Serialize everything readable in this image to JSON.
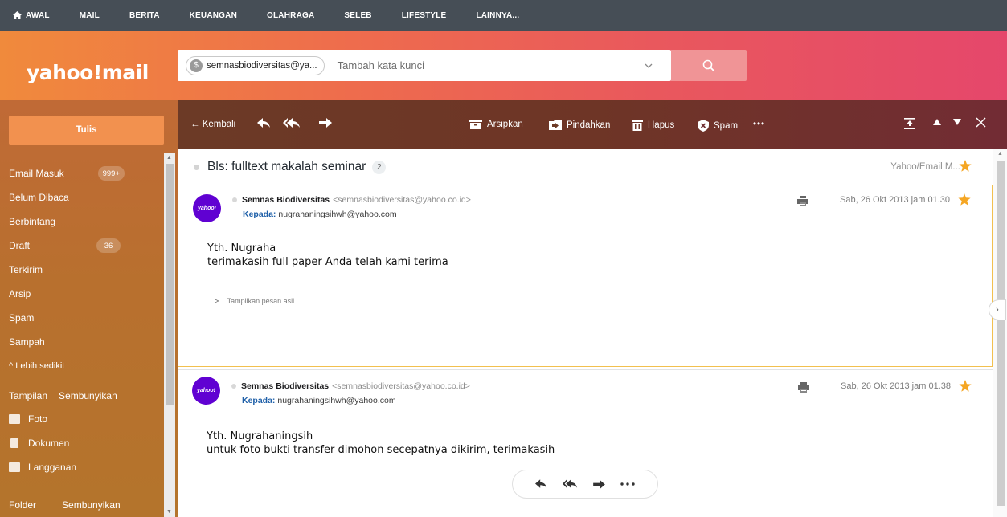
{
  "topnav": {
    "items": [
      "AWAL",
      "MAIL",
      "BERITA",
      "KEUANGAN",
      "OLAHRAGA",
      "SELEB",
      "LIFESTYLE",
      "LAINNYA..."
    ]
  },
  "header": {
    "logo": "yahoo!mail",
    "search": {
      "account_chip": "semnasbiodiversitas@ya...",
      "placeholder": "Tambah kata kunci"
    }
  },
  "sidebar": {
    "compose_label": "Tulis",
    "folders": [
      {
        "label": "Email Masuk",
        "badge": "999+"
      },
      {
        "label": "Belum Dibaca",
        "badge": ""
      },
      {
        "label": "Berbintang",
        "badge": ""
      },
      {
        "label": "Draft",
        "badge": "36"
      },
      {
        "label": "Terkirim",
        "badge": ""
      },
      {
        "label": "Arsip",
        "badge": ""
      },
      {
        "label": "Spam",
        "badge": ""
      },
      {
        "label": "Sampah",
        "badge": ""
      }
    ],
    "less_label": "^ Lebih sedikit",
    "views_label": "Tampilan",
    "views_hide": "Sembunyikan",
    "views": [
      "Foto",
      "Dokumen",
      "Langganan"
    ],
    "folder_label": "Folder",
    "folder_hide": "Sembunyikan"
  },
  "toolbar": {
    "back_label": "← Kembali",
    "archive_label": "Arsipkan",
    "move_label": "Pindahkan",
    "delete_label": "Hapus",
    "spam_label": "Spam",
    "more_label": "•••"
  },
  "conversation": {
    "subject": "Bls: fulltext makalah seminar",
    "count": "2",
    "folder": "Yahoo/Email M...",
    "messages": [
      {
        "avatar": "yahoo!",
        "sender_name": "Semnas Biodiversitas",
        "sender_email": "<semnasbiodiversitas@yahoo.co.id>",
        "to_label": "Kepada:",
        "to": "nugrahaningsihwh@yahoo.com",
        "date": "Sab, 26 Okt 2013 jam 01.30",
        "body_line1": "Yth. Nugraha",
        "body_line2": "terimakasih full paper Anda telah kami terima",
        "show_original": "Tampilkan pesan asli"
      },
      {
        "avatar": "yahoo!",
        "sender_name": "Semnas Biodiversitas",
        "sender_email": "<semnasbiodiversitas@yahoo.co.id>",
        "to_label": "Kepada:",
        "to": "nugrahaningsihwh@yahoo.com",
        "date": "Sab, 26 Okt 2013 jam 01.38",
        "body_line1": "Yth. Nugrahaningsih",
        "body_line2": "untuk foto bukti transfer dimohon secepatnya dikirim, terimakasih"
      }
    ]
  },
  "colors": {
    "topnav_bg": "#464e56",
    "accent_orange": "#f2914f",
    "star": "#f5a623",
    "avatar_purple": "#6001d2",
    "selected_border": "#f2c04e"
  }
}
